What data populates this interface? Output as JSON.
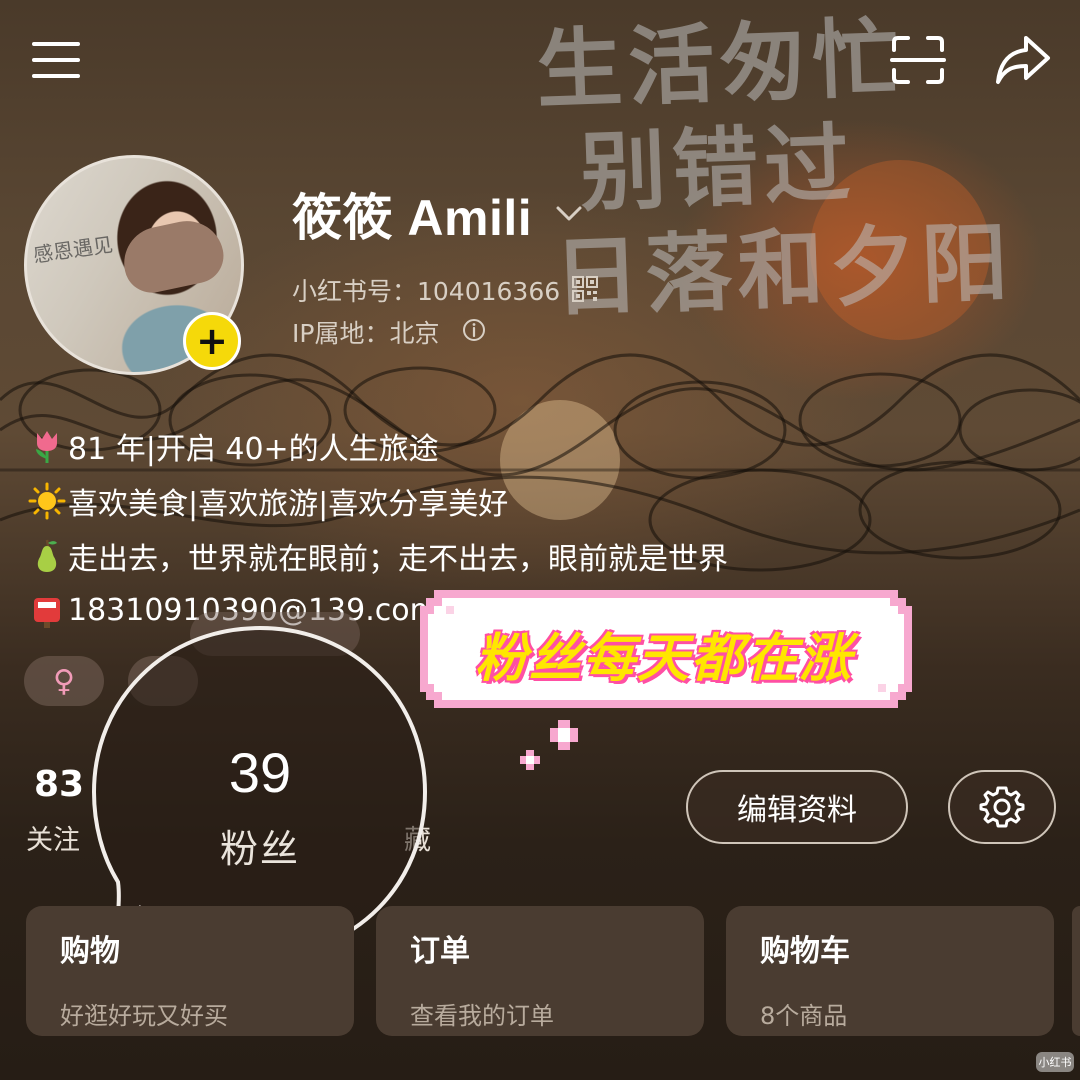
{
  "header": {
    "menu_icon": "menu-icon",
    "scan_icon": "scan-icon",
    "share_icon": "share-icon"
  },
  "background": {
    "calligraphy_lines": [
      "生活匆忙",
      "别错过",
      "日落和夕阳"
    ]
  },
  "profile": {
    "name": "筱筱 Amili",
    "user_id": "小红书号：104016366",
    "ip_location": "IP属地：北京",
    "avatar_text": "感恩遇见",
    "add_badge": "+"
  },
  "bio": [
    {
      "emoji": "tulip",
      "text": "81 年|开启 40+的人生旅途"
    },
    {
      "emoji": "sun",
      "text": "喜欢美食|喜欢旅游|喜欢分享美好"
    },
    {
      "emoji": "pear",
      "text": "走出去，世界就在眼前；走不出去，眼前就是世界"
    },
    {
      "emoji": "mailbox",
      "text": "18310910390@139.com"
    }
  ],
  "tags": {
    "gender_symbol": "♀"
  },
  "stats": {
    "follow_count": "83",
    "follow_label": "关注",
    "fans_count": "39",
    "fans_label": "粉丝",
    "likes_label_partial": "藏"
  },
  "overlay": {
    "banner_text": "粉丝每天都在涨",
    "colors": {
      "banner_text": "#ffe600",
      "banner_outline": "#ff4fa3",
      "banner_border": "#f7a8cf"
    }
  },
  "actions": {
    "edit_label": "编辑资料",
    "settings_icon": "gear-icon"
  },
  "cards": [
    {
      "title": "购物",
      "subtitle": "好逛好玩又好买"
    },
    {
      "title": "订单",
      "subtitle": "查看我的订单"
    },
    {
      "title": "购物车",
      "subtitle": "8个商品"
    }
  ],
  "watermark": "小红书"
}
